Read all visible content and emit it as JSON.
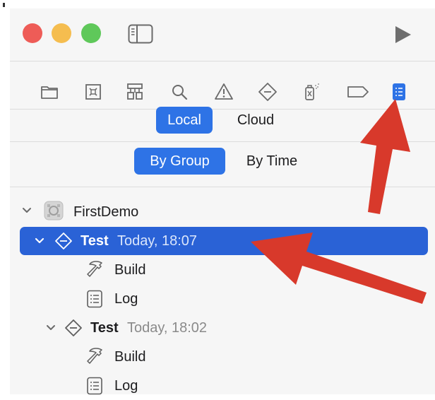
{
  "navigator": {
    "icons": [
      "folder-icon",
      "source-control-icon",
      "hierarchy-icon",
      "search-icon",
      "warning-icon",
      "test-icon",
      "debug-icon",
      "breakpoint-icon",
      "report-icon"
    ],
    "active_icon": "report-icon"
  },
  "segments": {
    "source": {
      "local_label": "Local",
      "cloud_label": "Cloud",
      "selected": "Local"
    },
    "grouping": {
      "by_group_label": "By Group",
      "by_time_label": "By Time",
      "selected": "By Group"
    }
  },
  "tree": {
    "project_name": "FirstDemo",
    "items": [
      {
        "title": "Test",
        "time": "Today, 18:07",
        "children": [
          "Build",
          "Log"
        ],
        "selected": true
      },
      {
        "title": "Test",
        "time": "Today, 18:02",
        "children": [
          "Build",
          "Log"
        ],
        "selected": false
      }
    ]
  },
  "colors": {
    "accent": "#2e73e6",
    "selection": "#2a62d6",
    "annotation_arrow": "#d8392b",
    "traffic_red": "#ee5c57",
    "traffic_yellow": "#f5bd4f",
    "traffic_green": "#5fc85a"
  }
}
